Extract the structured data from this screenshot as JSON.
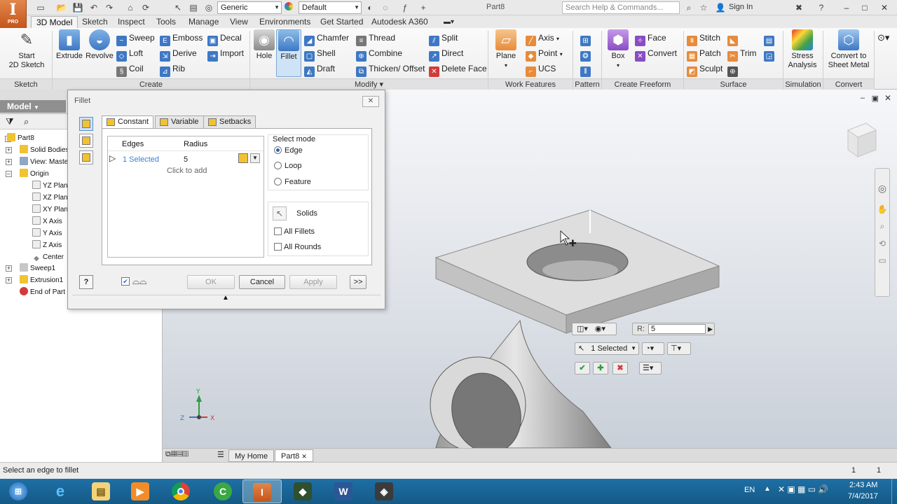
{
  "quick_access": {
    "appearance_combo": "Generic",
    "material_combo": "Default",
    "document_title": "Part8",
    "help_placeholder": "Search Help & Commands...",
    "sign_in": "Sign In"
  },
  "ribbon_tabs": [
    "3D Model",
    "Sketch",
    "Inspect",
    "Tools",
    "Manage",
    "View",
    "Environments",
    "Get Started",
    "Autodesk A360"
  ],
  "ribbon": {
    "sketch": {
      "label": "Sketch",
      "start_sketch": "Start\n2D Sketch"
    },
    "create": {
      "label": "Create",
      "extrude": "Extrude",
      "revolve": "Revolve",
      "sweep": "Sweep",
      "loft": "Loft",
      "coil": "Coil",
      "emboss": "Emboss",
      "derive": "Derive",
      "rib": "Rib",
      "decal": "Decal",
      "import": "Import"
    },
    "modify": {
      "label": "Modify",
      "hole": "Hole",
      "fillet": "Fillet",
      "chamfer": "Chamfer",
      "shell": "Shell",
      "draft": "Draft",
      "thread": "Thread",
      "combine": "Combine",
      "thicken": "Thicken/ Offset",
      "split": "Split",
      "direct": "Direct",
      "delete_face": "Delete Face"
    },
    "work_features": {
      "label": "Work Features",
      "plane": "Plane",
      "axis": "Axis",
      "point": "Point",
      "ucs": "UCS"
    },
    "pattern": {
      "label": "Pattern"
    },
    "create_freeform": {
      "label": "Create Freeform",
      "box": "Box",
      "face": "Face",
      "convert": "Convert"
    },
    "surface": {
      "label": "Surface",
      "stitch": "Stitch",
      "patch": "Patch",
      "sculpt": "Sculpt",
      "trim": "Trim"
    },
    "simulation": {
      "label": "Simulation",
      "stress": "Stress\nAnalysis"
    },
    "convert": {
      "label": "Convert",
      "sheet_metal": "Convert to\nSheet Metal"
    }
  },
  "browser": {
    "title": "Model",
    "items": [
      {
        "label": "Part8"
      },
      {
        "label": "Solid Bodies"
      },
      {
        "label": "View: Maste"
      },
      {
        "label": "Origin"
      },
      {
        "label": "YZ Plan"
      },
      {
        "label": "XZ Plan"
      },
      {
        "label": "XY Plan"
      },
      {
        "label": "X Axis"
      },
      {
        "label": "Y Axis"
      },
      {
        "label": "Z Axis"
      },
      {
        "label": "Center"
      },
      {
        "label": "Sweep1"
      },
      {
        "label": "Extrusion1"
      },
      {
        "label": "End of Part"
      }
    ]
  },
  "fillet_dialog": {
    "title": "Fillet",
    "tabs": [
      "Constant",
      "Variable",
      "Setbacks"
    ],
    "col_edges": "Edges",
    "col_radius": "Radius",
    "row_edges": "1 Selected",
    "row_radius": "5",
    "click_to_add": "Click to add",
    "select_mode_label": "Select mode",
    "mode_edge": "Edge",
    "mode_loop": "Loop",
    "mode_feature": "Feature",
    "solids": "Solids",
    "all_fillets": "All Fillets",
    "all_rounds": "All Rounds",
    "ok": "OK",
    "cancel": "Cancel",
    "apply": "Apply",
    "more": ">>"
  },
  "mini_toolbar": {
    "radius_label": "R:",
    "radius_value": "5",
    "selection": "1 Selected"
  },
  "doc_tabs": [
    "My Home",
    "Part8"
  ],
  "status": {
    "prompt": "Select an edge to fillet",
    "count1": "1",
    "count2": "1"
  },
  "taskbar": {
    "language": "EN",
    "time": "2:43 AM",
    "date": "7/4/2017"
  }
}
